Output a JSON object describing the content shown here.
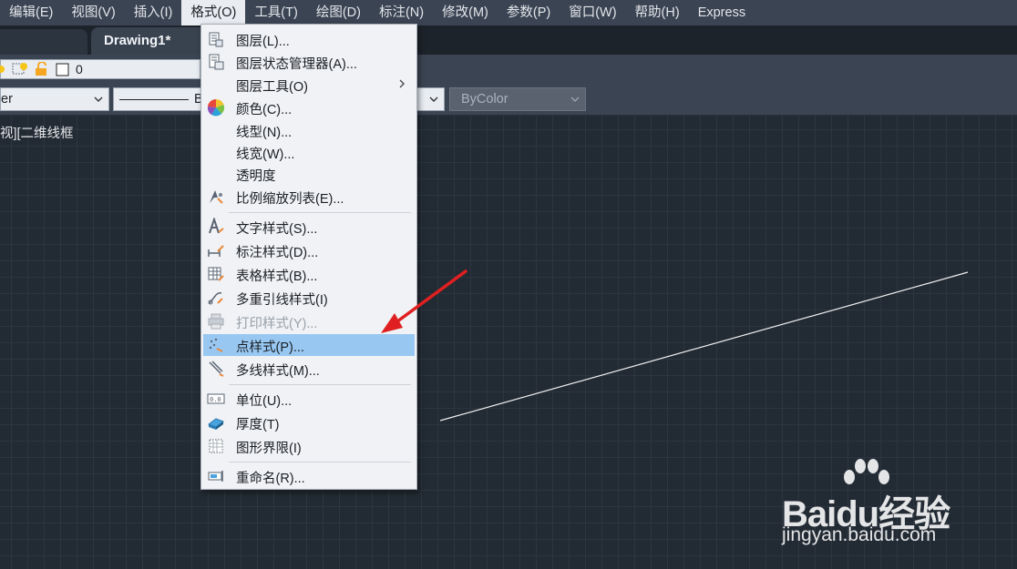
{
  "menubar": {
    "items": [
      "编辑(E)",
      "视图(V)",
      "插入(I)",
      "格式(O)",
      "工具(T)",
      "绘图(D)",
      "标注(N)",
      "修改(M)",
      "参数(P)",
      "窗口(W)",
      "帮助(H)",
      "Express"
    ],
    "active": "格式(O)"
  },
  "tabs": {
    "active_title": "Drawing1*"
  },
  "toolbar": {
    "current_layer": "0",
    "layer_combo_text": "er",
    "linetype_combo_text": "B",
    "color_combo_text": "ByColor"
  },
  "viewport": {
    "label": "视][二维线框"
  },
  "format_menu": {
    "items": [
      {
        "label": "图层(L)...",
        "icon": "layer-icon"
      },
      {
        "label": "图层状态管理器(A)...",
        "icon": "layer-state-icon"
      },
      {
        "label": "图层工具(O)",
        "icon": "",
        "submenu": true
      },
      {
        "label": "颜色(C)...",
        "icon": "color-wheel-icon"
      },
      {
        "label": "线型(N)...",
        "icon": ""
      },
      {
        "label": "线宽(W)...",
        "icon": ""
      },
      {
        "label": "透明度",
        "icon": ""
      },
      {
        "label": "比例缩放列表(E)...",
        "icon": "scale-list-icon"
      },
      {
        "label": "文字样式(S)...",
        "icon": "text-style-icon"
      },
      {
        "label": "标注样式(D)...",
        "icon": "dimension-style-icon"
      },
      {
        "label": "表格样式(B)...",
        "icon": "table-style-icon"
      },
      {
        "label": "多重引线样式(I)",
        "icon": "multileader-style-icon"
      },
      {
        "label": "打印样式(Y)...",
        "icon": "plot-style-icon",
        "disabled": true
      },
      {
        "label": "点样式(P)...",
        "icon": "point-style-icon",
        "highlighted": true
      },
      {
        "label": "多线样式(M)...",
        "icon": "multiline-style-icon"
      },
      {
        "label": "单位(U)...",
        "icon": "units-icon"
      },
      {
        "label": "厚度(T)",
        "icon": "thickness-icon"
      },
      {
        "label": "图形界限(I)",
        "icon": "drawing-limits-icon"
      },
      {
        "label": "重命名(R)...",
        "icon": "rename-icon"
      }
    ]
  },
  "watermark": {
    "brand": "Baidu经验",
    "url": "jingyan.baidu.com"
  },
  "colors": {
    "highlight": "#98c8f2",
    "arrow": "#e02020",
    "canvas": "#222a33"
  }
}
